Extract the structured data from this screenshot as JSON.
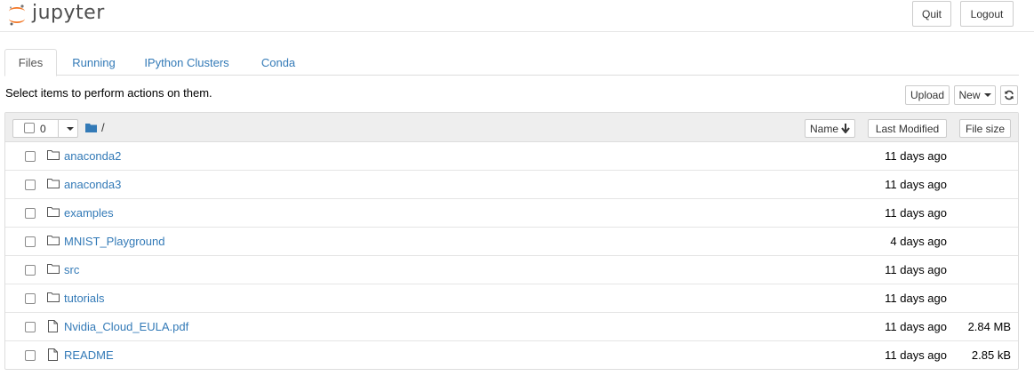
{
  "header": {
    "logo_text": "jupyter",
    "quit_label": "Quit",
    "logout_label": "Logout"
  },
  "tabs": [
    {
      "label": "Files",
      "active": true
    },
    {
      "label": "Running",
      "active": false
    },
    {
      "label": "IPython Clusters",
      "active": false
    },
    {
      "label": "Conda",
      "active": false
    }
  ],
  "toolbar": {
    "hint": "Select items to perform actions on them.",
    "upload_label": "Upload",
    "new_label": "New",
    "refresh_icon": "refresh-icon"
  },
  "list_header": {
    "selected_count": "0",
    "breadcrumb_path": "/",
    "sort_name_label": "Name",
    "last_modified_label": "Last Modified",
    "file_size_label": "File size"
  },
  "files": [
    {
      "name": "anaconda2",
      "type": "folder",
      "modified": "11 days ago",
      "size": ""
    },
    {
      "name": "anaconda3",
      "type": "folder",
      "modified": "11 days ago",
      "size": ""
    },
    {
      "name": "examples",
      "type": "folder",
      "modified": "11 days ago",
      "size": ""
    },
    {
      "name": "MNIST_Playground",
      "type": "folder",
      "modified": "4 days ago",
      "size": ""
    },
    {
      "name": "src",
      "type": "folder",
      "modified": "11 days ago",
      "size": ""
    },
    {
      "name": "tutorials",
      "type": "folder",
      "modified": "11 days ago",
      "size": ""
    },
    {
      "name": "Nvidia_Cloud_EULA.pdf",
      "type": "file",
      "modified": "11 days ago",
      "size": "2.84 MB"
    },
    {
      "name": "README",
      "type": "file",
      "modified": "11 days ago",
      "size": "2.85 kB"
    }
  ],
  "colors": {
    "link": "#337ab7",
    "logo_orange": "#f37726",
    "header_gray": "#eeeeee"
  }
}
